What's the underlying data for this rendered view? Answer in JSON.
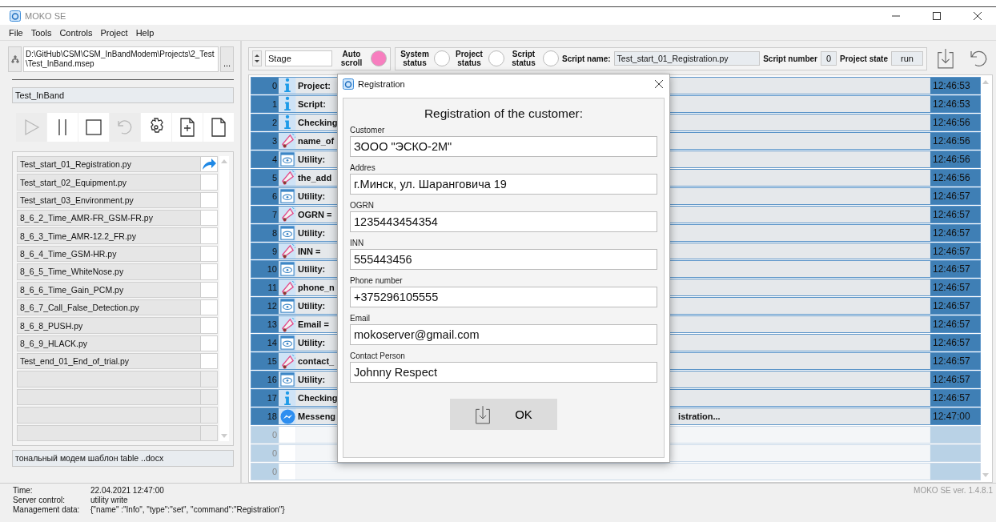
{
  "window": {
    "title": "MOKO SE"
  },
  "menu": [
    "File",
    "Tools",
    "Controls",
    "Project",
    "Help"
  ],
  "project": {
    "path": "D:\\GitHub\\CSM\\CSM_InBandModem\\Projects\\2_Test\\Test_InBand.msep",
    "browse": "...",
    "name": "Test_InBand"
  },
  "tools": [
    {
      "kind": "play",
      "disabled": true
    },
    {
      "kind": "pause",
      "disabled": false
    },
    {
      "kind": "stop",
      "disabled": false
    },
    {
      "kind": "undo",
      "disabled": true
    },
    {
      "kind": "settings",
      "disabled": false
    },
    {
      "kind": "new",
      "disabled": false
    },
    {
      "kind": "file",
      "disabled": false
    }
  ],
  "scripts": [
    {
      "name": "Test_start_01_Registration.py",
      "current": true
    },
    {
      "name": "Test_start_02_Equipment.py",
      "current": false
    },
    {
      "name": "Test_start_03_Environment.py",
      "current": false
    },
    {
      "name": "8_6_2_Time_AMR-FR_GSM-FR.py",
      "current": false
    },
    {
      "name": "8_6_3_Time_AMR-12.2_FR.py",
      "current": false
    },
    {
      "name": "8_6_4_Time_GSM-HR.py",
      "current": false
    },
    {
      "name": "8_6_5_Time_WhiteNose.py",
      "current": false
    },
    {
      "name": "8_6_6_Time_Gain_PCM.py",
      "current": false
    },
    {
      "name": "8_6_7_Call_False_Detection.py",
      "current": false
    },
    {
      "name": "8_6_8_PUSH.py",
      "current": false
    },
    {
      "name": "8_6_9_HLACK.py",
      "current": false
    },
    {
      "name": "Test_end_01_End_of_trial.py",
      "current": false
    }
  ],
  "document": "тональный модем шаблон table ..docx",
  "toolbar": {
    "stage": "Stage",
    "auto_scroll": {
      "label": "Auto scroll",
      "on": true
    },
    "statuses": [
      {
        "label": "System status",
        "on": false
      },
      {
        "label": "Project status",
        "on": false
      },
      {
        "label": "Script status",
        "on": false
      }
    ],
    "script_name": {
      "label": "Script name:",
      "value": "Test_start_01_Registration.py"
    },
    "script_number": {
      "label": "Script number",
      "value": "0"
    },
    "project_state": {
      "label": "Project state",
      "value": "run"
    }
  },
  "log": [
    {
      "n": "0",
      "kind": "info",
      "text": "Project:",
      "time": "12:46:53"
    },
    {
      "n": "1",
      "kind": "info",
      "text": "Script:",
      "time": "12:46:53"
    },
    {
      "n": "2",
      "kind": "info",
      "text": "Checking",
      "time": "12:46:56"
    },
    {
      "n": "3",
      "kind": "megaphone",
      "text": "name_of",
      "time": "12:46:56"
    },
    {
      "n": "4",
      "kind": "eye",
      "text": "Utility:",
      "time": "12:46:56"
    },
    {
      "n": "5",
      "kind": "megaphone",
      "text": "the_add",
      "time": "12:46:56"
    },
    {
      "n": "6",
      "kind": "eye",
      "text": "Utility:",
      "time": "12:46:57"
    },
    {
      "n": "7",
      "kind": "megaphone",
      "text": "OGRN =",
      "time": "12:46:57"
    },
    {
      "n": "8",
      "kind": "eye",
      "text": "Utility:",
      "time": "12:46:57"
    },
    {
      "n": "9",
      "kind": "megaphone",
      "text": "INN =",
      "time": "12:46:57"
    },
    {
      "n": "10",
      "kind": "eye",
      "text": "Utility:",
      "time": "12:46:57"
    },
    {
      "n": "11",
      "kind": "megaphone",
      "text": "phone_n",
      "time": "12:46:57"
    },
    {
      "n": "12",
      "kind": "eye",
      "text": "Utility:",
      "time": "12:46:57"
    },
    {
      "n": "13",
      "kind": "megaphone",
      "text": "Email =",
      "time": "12:46:57"
    },
    {
      "n": "14",
      "kind": "eye",
      "text": "Utility:",
      "time": "12:46:57"
    },
    {
      "n": "15",
      "kind": "megaphone",
      "text": "contact_",
      "time": "12:46:57"
    },
    {
      "n": "16",
      "kind": "eye",
      "text": "Utility:",
      "time": "12:46:57"
    },
    {
      "n": "17",
      "kind": "info",
      "text": "Checking",
      "time": "12:46:57"
    },
    {
      "n": "18",
      "kind": "messenger",
      "text": "Messeng",
      "tail": "istration...",
      "time": "12:47:00"
    },
    {
      "n": "0",
      "kind": "empty"
    },
    {
      "n": "0",
      "kind": "empty"
    },
    {
      "n": "0",
      "kind": "empty"
    }
  ],
  "status_bar": {
    "rows": [
      {
        "label": "Time:",
        "value": "22.04.2021    12:47:00"
      },
      {
        "label": "Server control:",
        "value": "utility write"
      },
      {
        "label": "Management data:",
        "value": "{\"name\" :\"Info\", \"type\":\"set\", \"command\":\"Registration\"}"
      }
    ],
    "version": "MOKO SE ver. 1.4.8.1"
  },
  "dialog": {
    "title": "Registration",
    "heading": "Registration of the customer:",
    "fields": [
      {
        "label": "Customer",
        "value": "ЗООО \"ЭСКО-2М\""
      },
      {
        "label": "Addres",
        "value": "г.Минск, ул. Шаранговича 19"
      },
      {
        "label": "OGRN",
        "value": "1235443454354"
      },
      {
        "label": "INN",
        "value": "555443456"
      },
      {
        "label": "Phone number",
        "value": "+375296105555"
      },
      {
        "label": "Email",
        "value": "mokoserver@gmail.com"
      },
      {
        "label": "Contact Person",
        "value": "Johnny Respect"
      }
    ],
    "ok": "OK"
  }
}
